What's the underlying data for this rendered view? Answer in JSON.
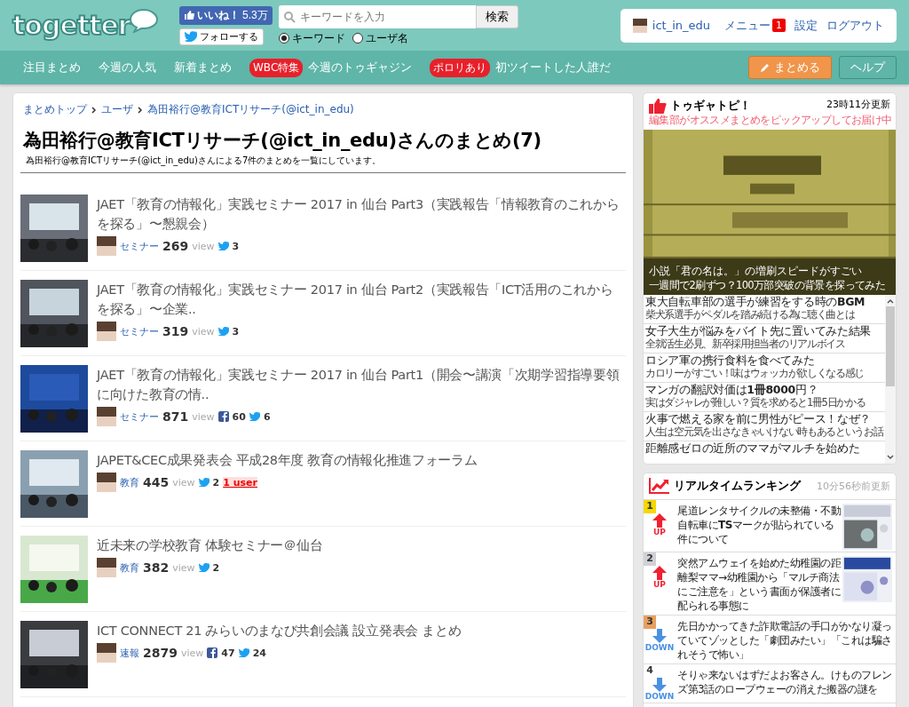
{
  "header": {
    "logo": "togetter",
    "like": {
      "label": "いいね！",
      "count": "5.3万"
    },
    "follow": "フォローする",
    "search": {
      "placeholder": "キーワードを入力",
      "button": "検索",
      "modes": [
        {
          "label": "キーワード",
          "selected": true
        },
        {
          "label": "ユーザ名",
          "selected": false
        }
      ]
    },
    "user": {
      "name": "ict_in_edu",
      "menu": "メニュー",
      "menu_badge": "1",
      "links": [
        "設定",
        "ログアウト"
      ]
    }
  },
  "nav": {
    "items": [
      {
        "label": "注目まとめ"
      },
      {
        "label": "今週の人気"
      },
      {
        "label": "新着まとめ"
      },
      {
        "badge": "WBC特集",
        "label": "今週のトゥギャジン"
      },
      {
        "badge": "ポロリあり",
        "label": "初ツイートした人誰だ"
      }
    ],
    "buttons": [
      {
        "kind": "primary",
        "label": "まとめる"
      },
      {
        "kind": "secondary",
        "label": "ヘルプ"
      }
    ]
  },
  "breadcrumbs": [
    "まとめトップ",
    "ユーザ",
    "為田裕行@教育ICTリサーチ(@ict_in_edu)"
  ],
  "page_title": "為田裕行@教育ICTリサーチ(@ict_in_edu)さんのまとめ(7)",
  "page_description": "為田裕行@教育ICTリサーチ(@ict_in_edu)さんによる7件のまとめを一覧にしています。",
  "articles": [
    {
      "title": "JAET「教育の情報化」実践セミナー 2017 in 仙台 Part3（実践報告「情報教育のこれからを探る」〜懇親会）",
      "category": "セミナー",
      "views": "269",
      "view_label": "view",
      "tweets": "3"
    },
    {
      "title": "JAET「教育の情報化」実践セミナー 2017 in 仙台 Part2（実践報告「ICT活用のこれからを探る」〜企業..",
      "category": "セミナー",
      "views": "319",
      "view_label": "view",
      "tweets": "3"
    },
    {
      "title": "JAET「教育の情報化」実践セミナー 2017 in 仙台 Part1（開会〜講演「次期学習指導要領に向けた教育の情..",
      "category": "セミナー",
      "views": "871",
      "view_label": "view",
      "likes": "60",
      "tweets": "6"
    },
    {
      "title": "JAPET&CEC成果発表会 平成28年度 教育の情報化推進フォーラム",
      "category": "教育",
      "views": "445",
      "view_label": "view",
      "tweets": "2",
      "users": "1 user"
    },
    {
      "title": "近未来の学校教育 体験セミナー＠仙台",
      "category": "教育",
      "views": "382",
      "view_label": "view",
      "tweets": "2"
    },
    {
      "title": "ICT CONNECT 21 みらいのまなび共創会議 設立発表会 まとめ",
      "category": "速報",
      "views": "2879",
      "view_label": "view",
      "likes": "47",
      "tweets": "24"
    }
  ],
  "topics": {
    "title": "トゥギャトピ！",
    "updated": "23時11分更新",
    "subtitle": "編集部がオススメまとめをピックアップしてお届け中",
    "feature": {
      "title": "小説「君の名は。」の増刷スピードがすごい",
      "subtitle": "一週間で2刷ずつ？100万部突破の背景を探ってみた"
    },
    "items": [
      {
        "title": "東大自転車部の選手が練習をする時の**BGM**",
        "subtitle": "柴犬系選手がペダルを踏み続ける為に聴く曲とは"
      },
      {
        "title": "女子大生が悩みをバイト先に置いてみた結果",
        "subtitle": "全就活生必見、新卒採用担当者のリアルボイス"
      },
      {
        "title": "ロシア軍の携行食料を食べてみた",
        "subtitle": "カロリーがすごい！味はウォッカが欲しくなる感じ"
      },
      {
        "title": "マンガの翻訳対価は**1冊8000**円？",
        "subtitle": "実はダジャレが難しい？質を求めると1冊5日かかる"
      },
      {
        "title": "火事で燃える家を前に男性がピース！なぜ？",
        "subtitle": "人生は空元気を出さなきゃいけない時もあるというお話"
      },
      {
        "title": "距離感ゼロの近所のママがマルチを始めた"
      }
    ]
  },
  "ranking": {
    "title": "リアルタイムランキング",
    "updated": "10分56秒前更新",
    "items": [
      {
        "rank": "1",
        "color": "#f5d800",
        "kind": "up",
        "trend_label": "UP",
        "title": "尾道レンタサイクルの未整備・不動自転車に**TS**マークが貼られている件について",
        "thumbnail": true
      },
      {
        "rank": "2",
        "color": "#d0d0d8",
        "kind": "up",
        "trend_label": "UP",
        "title": "突然アムウェイを始めた幼稚園の距離梨ママ→幼稚園から「マルチ商法にご注意を」という書面が保護者に配られる事態に",
        "thumbnail": true
      },
      {
        "rank": "3",
        "color": "#e8a060",
        "kind": "down",
        "trend_label": "DOWN",
        "title": "先日かかってきた詐欺電話の手口がかなり凝っていてゾッとした「劇団みたい」「これは騙されそうで怖い」",
        "thumbnail": false
      },
      {
        "rank": "4",
        "kind": "down",
        "trend_label": "DOWN",
        "title": "そりゃ来ないはずだよお客さん。けものフレンズ第3話のロープウェーの消えた搬器の謎を",
        "thumbnail": false
      }
    ]
  }
}
